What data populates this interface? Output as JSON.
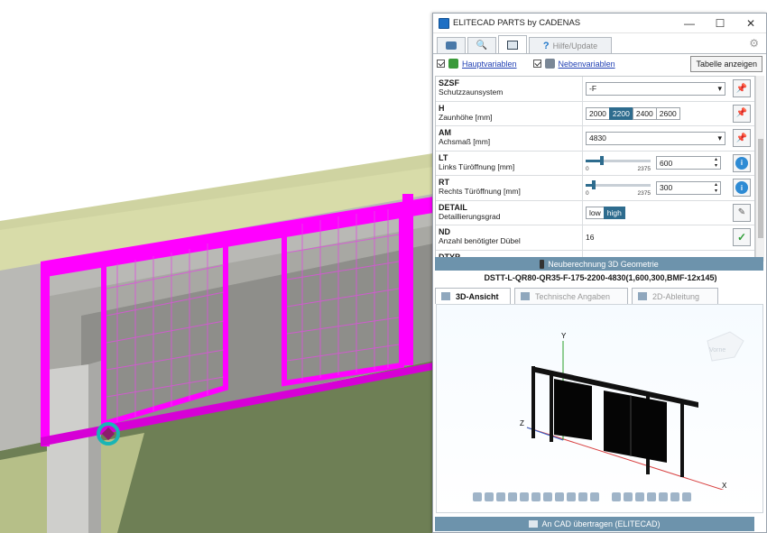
{
  "window": {
    "title": "ELITECAD PARTS by CADENAS",
    "controls": {
      "minimize": "—",
      "maximize": "☐",
      "close": "✕"
    }
  },
  "tabs": {
    "help_label": "Hilfe/Update"
  },
  "variables": {
    "main_label": "Hauptvariablen",
    "secondary_label": "Nebenvariablen",
    "table_button": "Tabelle anzeigen"
  },
  "params": [
    {
      "code": "SZSF",
      "desc": "Schutzzaunsystem",
      "value": "-F"
    },
    {
      "code": "H",
      "desc": "Zaunhöhe [mm]",
      "options": [
        "2000",
        "2200",
        "2400",
        "2600"
      ],
      "selected": "2200"
    },
    {
      "code": "AM",
      "desc": "Achsmaß [mm]",
      "value": "4830"
    },
    {
      "code": "LT",
      "desc": "Links Türöffnung [mm]",
      "min": "0",
      "max": "2375",
      "value": "600",
      "fraction": 0.25
    },
    {
      "code": "RT",
      "desc": "Rechts Türöffnung [mm]",
      "min": "0",
      "max": "2375",
      "value": "300",
      "fraction": 0.13
    },
    {
      "code": "DETAIL",
      "desc": "Detaillierungsgrad",
      "options": [
        "low",
        "high"
      ],
      "selected": "high"
    },
    {
      "code": "ND",
      "desc": "Anzahl benötigter Dübel",
      "value": "16"
    },
    {
      "code": "DTYP",
      "desc": ""
    }
  ],
  "recalc_label": "Neuberechnung 3D Geometrie",
  "part_number": "DSTT-L-QR80-QR35-F-175-2200-4830(1,600,300,BMF-12x145)",
  "view_tabs": [
    "3D-Ansicht",
    "Technische Angaben",
    "2D-Ableitung"
  ],
  "axes": {
    "x": "X",
    "y": "Y",
    "z": "Z"
  },
  "transfer_label": "An CAD übertragen (ELITECAD)",
  "colors": {
    "accent": "#6d93ac",
    "selection": "#2e6c8e",
    "fence": "#ff00ff"
  }
}
